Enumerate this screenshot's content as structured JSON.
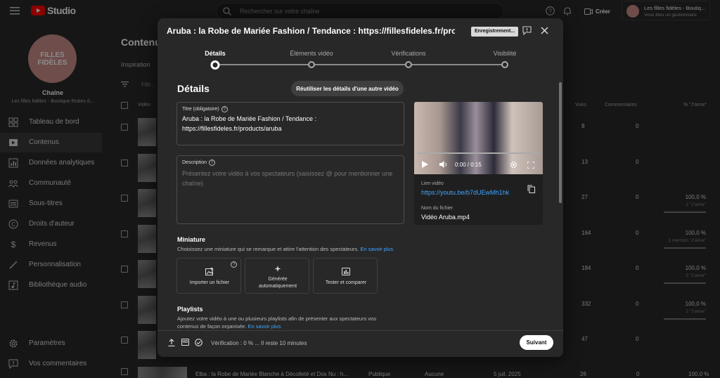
{
  "app": {
    "logo_text": "Studio",
    "search_placeholder": "Rechercher sur votre chaîne",
    "create_label": "Créer",
    "account_name": "Les filles fidèles - Boutiq...",
    "account_sub": "Vous êtes un gestionnaire",
    "channel_avatar_text": "FILLES FIDÈLES",
    "channel_label": "Chaîne",
    "channel_name": "Les filles fidèles - Boutique Robes d...",
    "page_title": "Contenu",
    "tab_inspiration": "Inspiration",
    "filter_label": "Filtr...",
    "col_video": "Vidéo",
    "col_views": "Vues",
    "col_comments": "Commentaires",
    "col_likes": "% \"J'aime\"",
    "sidebar": [
      {
        "label": "Tableau de bord",
        "icon": "dashboard-icon"
      },
      {
        "label": "Contenus",
        "icon": "content-icon",
        "active": true
      },
      {
        "label": "Données analytiques",
        "icon": "analytics-icon"
      },
      {
        "label": "Communauté",
        "icon": "community-icon"
      },
      {
        "label": "Sous-titres",
        "icon": "subtitles-icon"
      },
      {
        "label": "Droits d'auteur",
        "icon": "copyright-icon"
      },
      {
        "label": "Revenus",
        "icon": "dollar-icon"
      },
      {
        "label": "Personnalisation",
        "icon": "wand-icon"
      },
      {
        "label": "Bibliothèque audio",
        "icon": "audio-library-icon"
      }
    ],
    "sidebar_bottom": [
      {
        "label": "Paramètres",
        "icon": "gear-icon"
      },
      {
        "label": "Vos commentaires",
        "icon": "feedback-icon"
      }
    ],
    "rows": [
      {
        "views": "8",
        "comments": "0",
        "likes": "",
        "likes_sub": "",
        "like_fill": 0
      },
      {
        "views": "13",
        "comments": "0",
        "likes": "",
        "likes_sub": "",
        "like_fill": 0
      },
      {
        "views": "27",
        "comments": "0",
        "likes": "100,0 %",
        "likes_sub": "2 \"J'aime\"",
        "like_fill": 1
      },
      {
        "views": "164",
        "comments": "0",
        "likes": "100,0 %",
        "likes_sub": "1 mention \"J'aime\"",
        "like_fill": 1
      },
      {
        "views": "184",
        "comments": "0",
        "likes": "100,0 %",
        "likes_sub": "2 \"J'aime\"",
        "like_fill": 1
      },
      {
        "views": "332",
        "comments": "0",
        "likes": "100,0 %",
        "likes_sub": "2 \"J'aime\"",
        "like_fill": 1
      },
      {
        "views": "47",
        "comments": "0",
        "likes": "",
        "likes_sub": "",
        "like_fill": 0
      }
    ],
    "last_row": {
      "title": "Elba : la Robe de Mariée Blanche à Décolleté et Dos Nu : h...",
      "visibility": "Publique",
      "restrictions": "Aucune",
      "date": "5 juil. 2025",
      "views": "26",
      "comments": "0",
      "likes": "100,0 %"
    }
  },
  "modal": {
    "title": "Aruba : la Robe de Mariée Fashion / Tendance : https://fillesfideles.fr/prod...",
    "save_badge": "Enregistrement...",
    "steps": [
      {
        "label": "Détails",
        "active": true
      },
      {
        "label": "Éléments vidéo",
        "active": false
      },
      {
        "label": "Vérifications",
        "active": false
      },
      {
        "label": "Visibilité",
        "active": false
      }
    ],
    "section_title": "Détails",
    "reuse_button": "Réutiliser les détails d'une autre vidéo",
    "title_field_label": "Titre (obligatoire)",
    "title_field_value_line1": "Aruba : la Robe de Mariée Fashion / Tendance :",
    "title_field_value_line2": "https://fillesfideles.fr/products/aruba",
    "desc_field_label": "Description",
    "desc_placeholder": "Présentez votre vidéo à vos spectateurs (saisissez @ pour mentionner une chaîne)",
    "miniature_title": "Miniature",
    "miniature_desc": "Choisissez une miniature qui se remarque et attire l'attention des spectateurs.",
    "learn_more": "En savoir plus",
    "thumb_options": [
      {
        "label": "Importer un fichier",
        "icon": "image-upload-icon"
      },
      {
        "label": "Générée automatiquement",
        "icon": "sparkle-icon"
      },
      {
        "label": "Tester et comparer",
        "icon": "ab-test-icon"
      }
    ],
    "playlists_title": "Playlists",
    "playlists_desc": "Ajoutez votre vidéo à une ou plusieurs playlists afin de présenter aux spectateurs vos contenus de façon organisée.",
    "player_time": "0:00 / 0:15",
    "video_link_label": "Lien vidéo",
    "video_link": "https://youtu.be/b7dUEwMh1hk",
    "file_name_label": "Nom du fichier",
    "file_name": "Vidéo Aruba.mp4",
    "footer_status": "Vérification : 0 % ... Il reste 10 minutes",
    "hd_badge": "HD",
    "next_button": "Suivant"
  }
}
